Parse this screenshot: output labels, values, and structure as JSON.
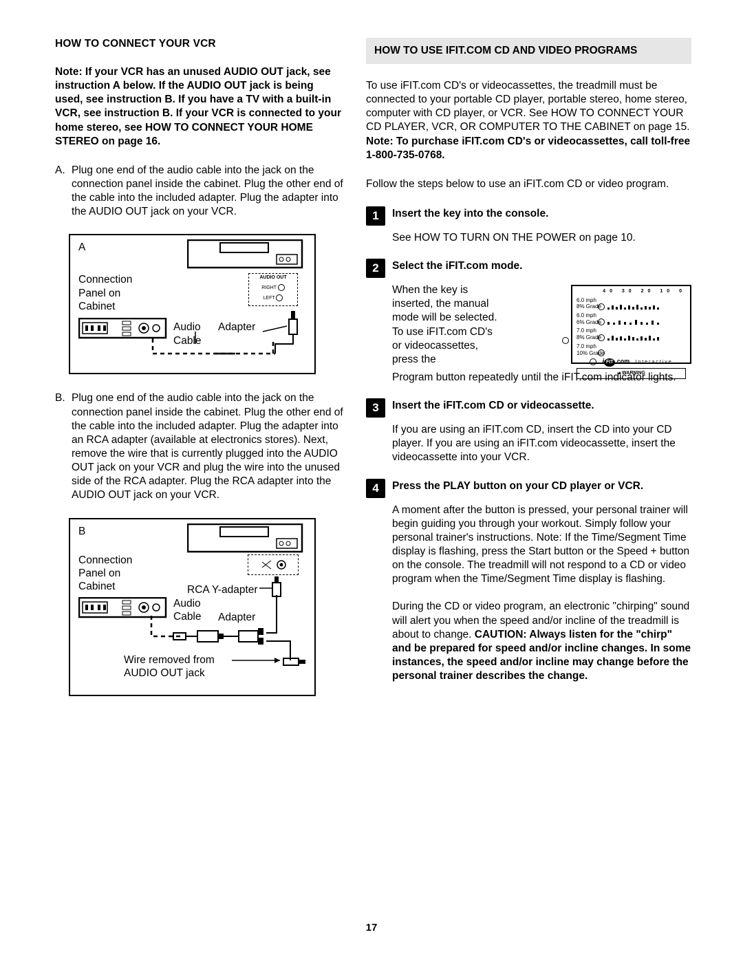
{
  "left": {
    "title": "HOW TO CONNECT YOUR VCR",
    "note": "Note: If your VCR has an unused AUDIO OUT jack, see instruction A below. If the AUDIO OUT jack is being used, see instruction B. If you have a TV with a built-in VCR, see instruction B. If your VCR is connected to your home stereo, see HOW TO CONNECT YOUR HOME STEREO on page 16.",
    "instrA_letter": "A.",
    "instrA": "Plug one end of the audio cable into the jack on the connection panel inside the cabinet. Plug the other end of the cable into the included adapter. Plug the adapter into the AUDIO OUT jack on your VCR.",
    "diagA": {
      "letter": "A",
      "connection": "Connection\nPanel on\nCabinet",
      "audio_cable": "Audio\nCable",
      "adapter": "Adapter",
      "audio_out": "AUDIO OUT",
      "right": "RIGHT",
      "left": "LEFT"
    },
    "instrB_letter": "B.",
    "instrB": "Plug one end of the audio cable into the jack on the connection panel inside the cabinet. Plug the other end of the cable into the included adapter. Plug the adapter into an RCA adapter (available at electronics stores). Next, remove the wire that is currently plugged into the AUDIO OUT jack on your VCR and plug the wire into the unused side of the RCA adapter. Plug the RCA adapter into the AUDIO OUT jack on your VCR.",
    "diagB": {
      "letter": "B",
      "connection": "Connection\nPanel on\nCabinet",
      "audio_cable": "Audio\nCable",
      "rca": "RCA Y-adapter",
      "adapter": "Adapter",
      "wire_removed": "Wire removed from\nAUDIO OUT jack"
    }
  },
  "right": {
    "title": "HOW TO USE IFIT.COM CD AND VIDEO PROGRAMS",
    "intro": "To use iFIT.com CD's or videocassettes, the treadmill must be connected to your portable CD player, portable stereo, home stereo, computer with CD player, or VCR. See HOW TO CONNECT YOUR CD PLAYER, VCR, OR COMPUTER TO THE CABINET on page 15. ",
    "intro_bold": "Note: To purchase iFIT.com CD's or videocassettes, call toll-free 1-800-735-0768.",
    "follow": "Follow the steps below to use an iFIT.com CD or video program.",
    "step1_title": "Insert the key into the console.",
    "step1_body": "See HOW TO TURN ON THE POWER on page 10.",
    "step2_title": "Select the iFIT.com mode.",
    "step2_body_a": "When the key is inserted, the manual mode will be selected. To use iFIT.com CD's or videocassettes, press the",
    "step2_body_b": "Program button repeatedly until the iFIT.com indicator lights.",
    "console": {
      "s1": "6.0 mph\n8% Grade",
      "s2": "6.0 mph\n6% Grade",
      "s3": "7.0 mph\n8% Grade",
      "s4": "7.0 mph\n10% Grade",
      "ifit": "iFIT.com",
      "inter": "Interactive",
      "warn": "▲WARNING",
      "top": "40   30   20   10   0"
    },
    "step3_title": "Insert the iFIT.com CD or videocassette.",
    "step3_body": "If you are using an iFIT.com CD, insert the CD into your CD player. If you are using an iFIT.com videocassette, insert the videocassette into your VCR.",
    "step4_title": "Press the PLAY button on your CD player or VCR.",
    "step4_body1": "A moment after the button is pressed, your personal trainer will begin guiding you through your workout. Simply follow your personal trainer's instructions. Note: If the Time/Segment Time display is flashing, press the Start button or the Speed + button on the console. The treadmill will not respond to a CD or video program when the Time/Segment Time display is flashing.",
    "step4_body2a": "During the CD or video program, an electronic \"chirping\" sound will alert you when the speed and/or incline of the treadmill is about to change. ",
    "step4_body2b": "CAUTION: Always listen for the \"chirp\" and be prepared for speed and/or incline changes. In some instances, the speed and/or incline may change before the personal trainer describes the change."
  },
  "page_number": "17"
}
